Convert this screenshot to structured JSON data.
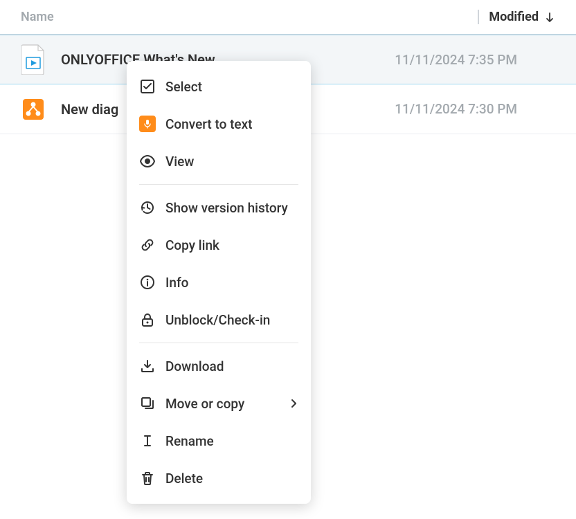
{
  "columns": {
    "name": "Name",
    "modified": "Modified"
  },
  "files": [
    {
      "name": "ONLYOFFICE What's New",
      "modified": "11/11/2024 7:35 PM",
      "icon": "video-file"
    },
    {
      "name": "New diag",
      "modified": "11/11/2024 7:30 PM",
      "icon": "diagram-file"
    }
  ],
  "context_menu": {
    "select": "Select",
    "convert": "Convert to text",
    "view": "View",
    "history": "Show version history",
    "copy_link": "Copy link",
    "info": "Info",
    "unblock": "Unblock/Check-in",
    "download": "Download",
    "move_copy": "Move or copy",
    "rename": "Rename",
    "delete": "Delete"
  }
}
